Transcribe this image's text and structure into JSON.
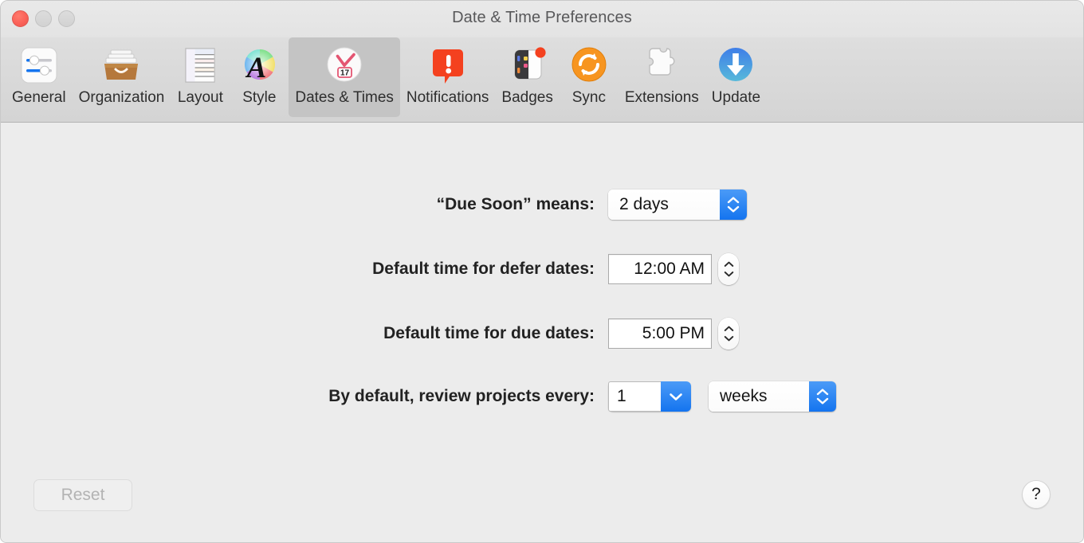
{
  "window": {
    "title": "Date & Time Preferences",
    "traffic_lights": [
      {
        "name": "close",
        "label": "Close",
        "color": "#fb6158",
        "enabled": true
      },
      {
        "name": "minimize",
        "label": "Minimize",
        "color": "#d6d6d6",
        "enabled": false
      },
      {
        "name": "zoom",
        "label": "Zoom",
        "color": "#d6d6d6",
        "enabled": false
      }
    ]
  },
  "toolbar": {
    "items": [
      {
        "label": "General",
        "icon": "sliders-icon",
        "selected": false
      },
      {
        "label": "Organization",
        "icon": "file-drawer-icon",
        "selected": false
      },
      {
        "label": "Layout",
        "icon": "layout-columns-icon",
        "selected": false
      },
      {
        "label": "Style",
        "icon": "color-wheel-a-icon",
        "selected": false
      },
      {
        "label": "Dates & Times",
        "icon": "clock-calendar-icon",
        "selected": true
      },
      {
        "label": "Notifications",
        "icon": "alert-bubble-icon",
        "selected": false
      },
      {
        "label": "Badges",
        "icon": "badge-dots-icon",
        "selected": false
      },
      {
        "label": "Sync",
        "icon": "sync-arrows-icon",
        "selected": false
      },
      {
        "label": "Extensions",
        "icon": "puzzle-piece-icon",
        "selected": false
      },
      {
        "label": "Update",
        "icon": "download-arrow-icon",
        "selected": false
      }
    ]
  },
  "settings": {
    "due_soon": {
      "label": "“Due Soon” means:",
      "value": "2 days",
      "control": "popup-button"
    },
    "defer_time": {
      "label": "Default time for defer dates:",
      "value": "12:00 AM",
      "control": "text-field-with-stepper"
    },
    "due_time": {
      "label": "Default time for due dates:",
      "value": "5:00 PM",
      "control": "text-field-with-stepper"
    },
    "review_interval": {
      "label": "By default, review projects every:",
      "count_value": "1",
      "unit_value": "weeks",
      "control": "combo-box-and-popup-button"
    }
  },
  "footer": {
    "reset_label": "Reset",
    "reset_enabled": false,
    "help_label": "?"
  },
  "colors": {
    "accent_blue": "#1474ef",
    "window_bg": "#ececec",
    "toolbar_bg": "#d8d8d8",
    "selected_tab_bg": "#c4c4c4",
    "close_red": "#fb6158"
  }
}
